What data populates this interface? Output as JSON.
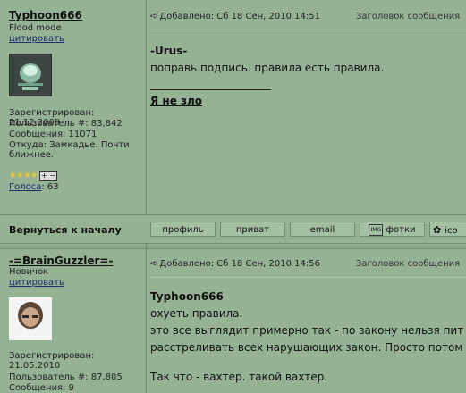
{
  "post1": {
    "author": "Typhoon666",
    "rank": "Flood mode",
    "quote_label": "цитировать",
    "stats": [
      "Зарегистрирован: 21.12.2009",
      "Пользователь #: 83,842",
      "Сообщения: 11071",
      "Откуда: Замкадье. Почти ближнее."
    ],
    "votes_label": "Голоса",
    "votes_value": ": 63",
    "header": "Добавлено: Сб 18 Сен, 2010 14:51",
    "subject_label": "Заголовок сообщения",
    "body_name": "-Urus-",
    "body_text": "поправь подпись. правила есть правила.",
    "signature": "Я не зло"
  },
  "nav": {
    "back_to_top": "Вернуться к началу",
    "buttons": [
      "профиль",
      "приват",
      "email",
      "фотки",
      "ico"
    ]
  },
  "post2": {
    "author": "-=BrainGuzzler=-",
    "rank": "Новичок",
    "quote_label": "цитировать",
    "stats": [
      "Зарегистрирован: 21.05.2010",
      "Пользователь #: 87,805",
      "Сообщения: 9"
    ],
    "header": "Добавлено: Сб 18 Сен, 2010 14:56",
    "subject_label": "Заголовок сообщения",
    "body_name": "Typhoon666",
    "lines": [
      "охуеть правила.",
      "это все выглядит примерно так - по закону нельзя пит",
      "расстреливать всех нарушающих закон. Просто потом",
      "",
      "Так что - вахтер. такой вахтер."
    ]
  }
}
